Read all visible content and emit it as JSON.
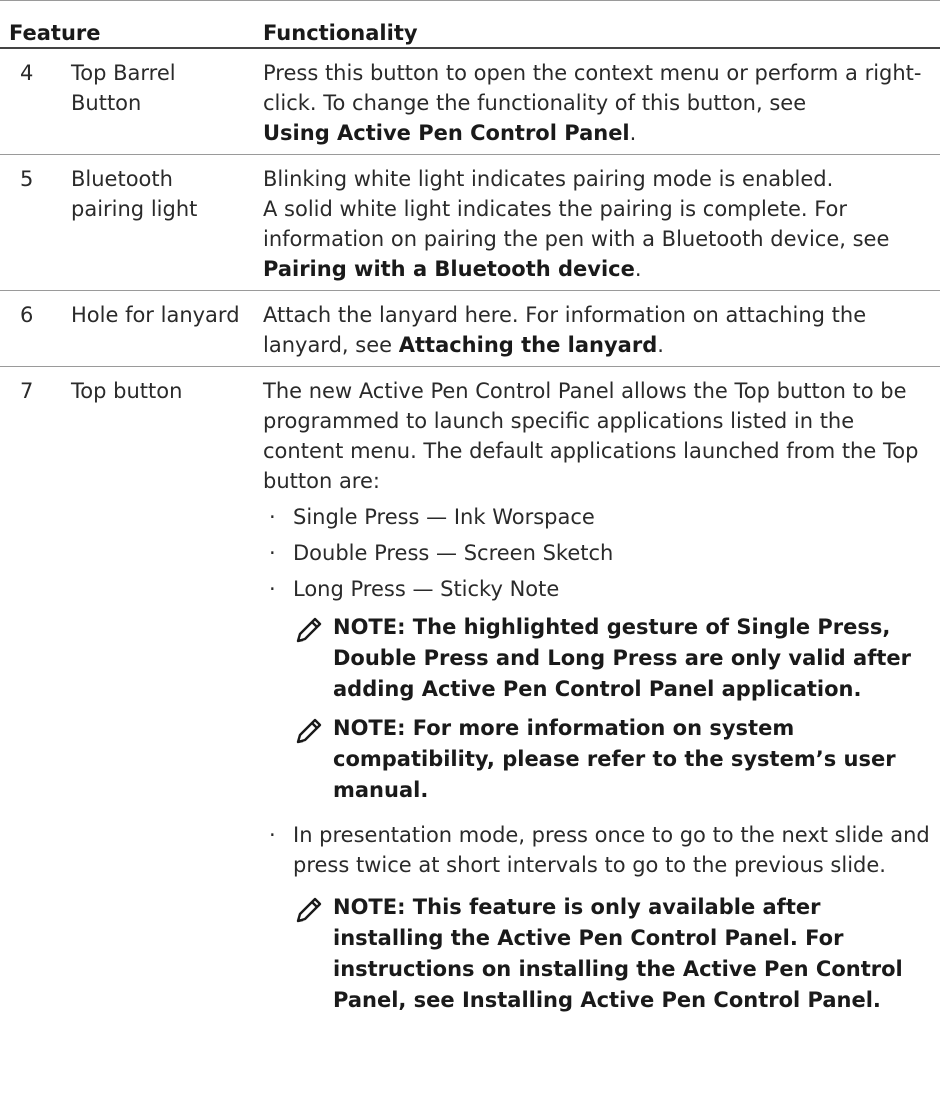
{
  "header": {
    "feature": "Feature",
    "functionality": "Functionality"
  },
  "rows": [
    {
      "num": "4",
      "feature": "Top Barrel Button",
      "text": "Press this button to open the context menu or perform a right-click. To change the functionality of this button, see",
      "link": "Using Active Pen Control Panel",
      "tail": "."
    },
    {
      "num": "5",
      "feature": "Bluetooth pairing light",
      "line1": "Blinking white light indicates pairing mode is enabled.",
      "text": "A solid white light indicates the pairing is complete. For information on pairing the pen with a Bluetooth device, see",
      "link": "Pairing with a Bluetooth device",
      "tail": "."
    },
    {
      "num": "6",
      "feature": "Hole for lanyard",
      "text": "Attach the lanyard here. For information on attaching the lanyard, see",
      "link": "Attaching the lanyard",
      "tail": "."
    },
    {
      "num": "7",
      "feature": "Top button",
      "intro": "The new Active Pen Control Panel allows the Top button to be programmed to launch specific applications listed in the content menu. The default applications launched from the Top button are:",
      "bullets": [
        "Single Press — Ink Worspace",
        "Double Press — Screen Sketch",
        "Long Press — Sticky Note"
      ],
      "note1": "NOTE: The highlighted gesture of Single Press, Double Press and Long Press are only valid after adding Active Pen Control Panel application.",
      "note2": "NOTE: For more information on system compatibility, please refer to the system’s user manual.",
      "bullet4": "In presentation mode, press once to go to the next slide and press twice at short intervals to go to the previous slide.",
      "note3": "NOTE: This feature is only available after installing the Active Pen Control Panel. For instructions on installing the Active Pen Control Panel, see Installing Active Pen Control Panel."
    }
  ],
  "icons": {
    "note": "pencil-note-icon",
    "bullet": "·"
  }
}
